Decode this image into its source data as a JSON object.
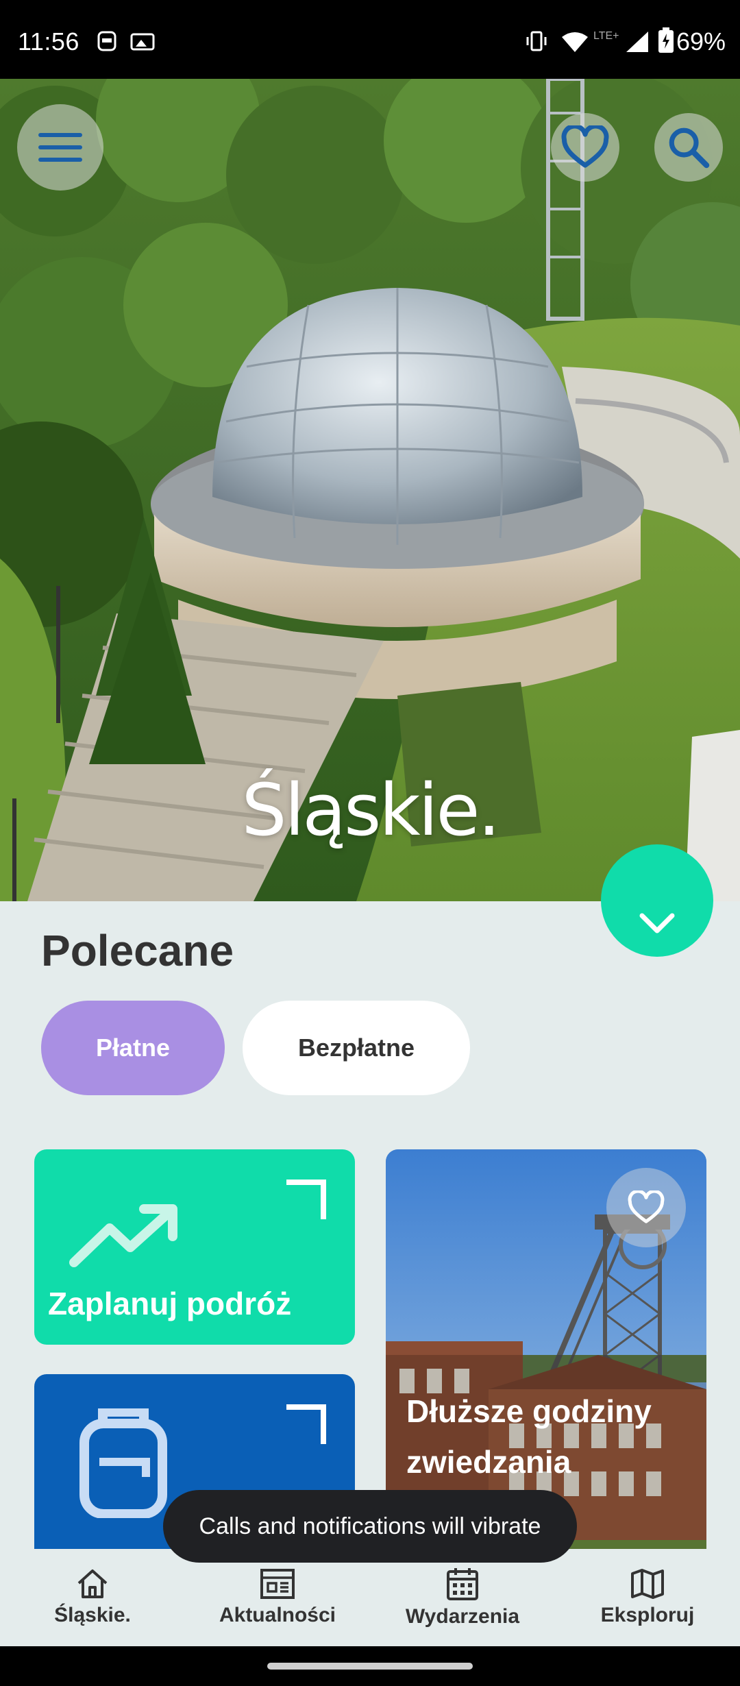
{
  "status_bar": {
    "time": "11:56",
    "network": "LTE+",
    "battery": "69%"
  },
  "hero": {
    "title": "Śląskie."
  },
  "sheet": {
    "title": "Polecane",
    "filters": [
      {
        "label": "Płatne",
        "selected": true
      },
      {
        "label": "Bezpłatne",
        "selected": false
      }
    ],
    "cards": [
      {
        "label": "Zaplanuj podróż",
        "icon": "trending-up-icon"
      },
      {
        "label": "",
        "icon": "backpack-icon"
      },
      {
        "label": "Dłuższe godziny zwiedzania",
        "icon": "heart-outline-icon"
      }
    ]
  },
  "toast": {
    "text": "Calls and notifications will vibrate"
  },
  "bottom_nav": {
    "items": [
      {
        "label": "Śląskie.",
        "icon": "home-icon",
        "active": true
      },
      {
        "label": "Aktualności",
        "icon": "news-icon"
      },
      {
        "label": "Wydarzenia",
        "icon": "calendar-icon"
      },
      {
        "label": "Eksploruj",
        "icon": "map-icon"
      }
    ]
  },
  "colors": {
    "accent_green": "#10dcaa",
    "chip_selected": "#a98fe3",
    "sheet_bg": "#e4ecec",
    "card_blue": "#0a5fb6",
    "hero_icon_blue": "#1a5fa8"
  }
}
